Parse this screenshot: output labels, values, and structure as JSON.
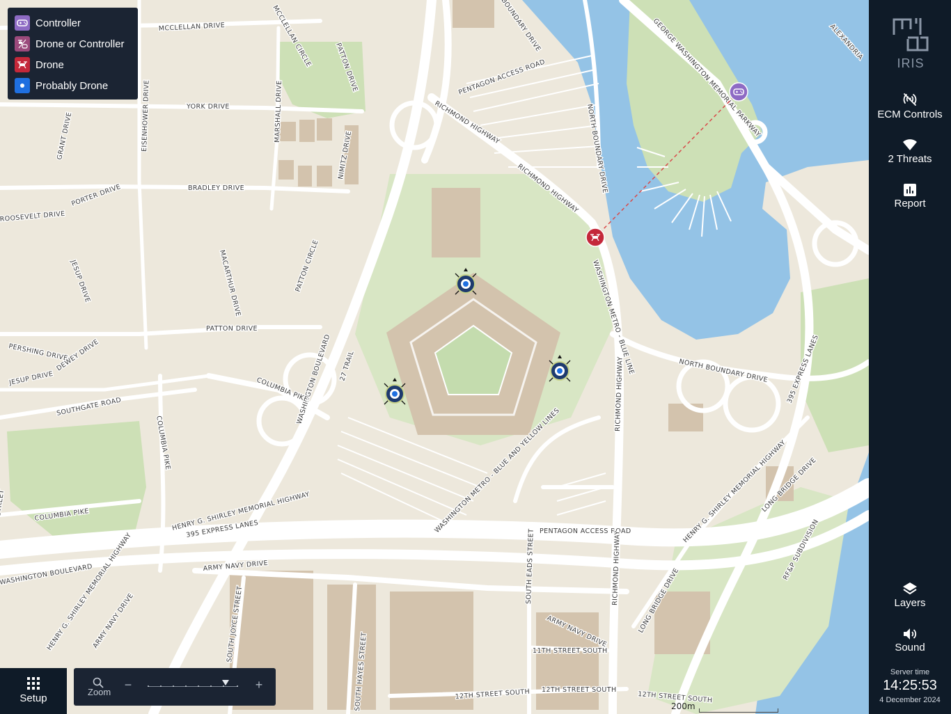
{
  "legend": {
    "items": [
      {
        "label": "Controller",
        "color": "#8e6bc4",
        "icon": "gamepad-icon"
      },
      {
        "label": "Drone or Controller",
        "color": "#9b4a7c",
        "icon": "drone-or-controller-icon"
      },
      {
        "label": "Drone",
        "color": "#c4283a",
        "icon": "drone-icon"
      },
      {
        "label": "Probably Drone",
        "color": "#1f6fe0",
        "icon": "dot-icon"
      }
    ]
  },
  "sidebar": {
    "logo_text": "IRIS",
    "ecm_label": "ECM Controls",
    "threats_label": "2 Threats",
    "report_label": "Report",
    "layers_label": "Layers",
    "sound_label": "Sound",
    "server_time_caption": "Server time",
    "server_time": "14:25:53",
    "server_date": "4 December 2024"
  },
  "controls": {
    "setup_label": "Setup",
    "zoom_label": "Zoom",
    "zoom_minus": "−",
    "zoom_plus": "+",
    "scale_label": "200m"
  },
  "map": {
    "colors": {
      "land": "#ede8dc",
      "water": "#94c3e6",
      "park": "#cde0b6",
      "road": "#ffffff",
      "building": "#d3c3ad"
    },
    "streets": [
      "MCCLELLAN DRIVE",
      "MCCLELLAN CIRCLE",
      "PATTON DRIVE",
      "BOUNDARY DRIVE",
      "PENTAGON ACCESS ROAD",
      "GEORGE WASHINGTON MEMORIAL PARKWAY",
      "ALEXANDRIA",
      "YORK DRIVE",
      "EISENHOWER DRIVE",
      "MARSHALL DRIVE",
      "NIMITZ DRIVE",
      "RICHMOND HIGHWAY",
      "NORTH BOUNDARY DRIVE",
      "GRANT DRIVE",
      "PORTER DRIVE",
      "BRADLEY DRIVE",
      "ROOSEVELT DRIVE",
      "MACARTHUR DRIVE",
      "JESUP DRIVE",
      "PATTON CIRCLE",
      "WASHINGTON METRO - BLUE LINE",
      "PATTON DRIVE",
      "PERSHING DRIVE",
      "DEWEY DRIVE",
      "WASHINGTON BOULEVARD",
      "27 TRAIL",
      "COLUMBIA PIKE",
      "SOUTHGATE ROAD",
      "395 EXPRESS LANES",
      "HENRY G. SHIRLEY MEMORIAL HIGHWAY",
      "WASHINGTON METRO - BLUE AND YELLOW LINES",
      "ARMY NAVY DRIVE",
      "SOUTH JOYCE STREET",
      "SOUTH EADS STREET",
      "11TH STREET SOUTH",
      "12TH STREET SOUTH",
      "SOUTH HAYES STREET",
      "LONG BRIDGE DRIVE",
      "RF&P SUBDIVISION",
      "STREET"
    ]
  },
  "markers": [
    {
      "type": "controller",
      "icon": "gamepad-icon",
      "color": "#8e6bc4"
    },
    {
      "type": "drone",
      "icon": "drone-icon",
      "color": "#c4283a"
    },
    {
      "type": "sensor",
      "icon": "sensor-icon",
      "color": "#1e3a6e"
    },
    {
      "type": "sensor",
      "icon": "sensor-icon",
      "color": "#1e3a6e"
    },
    {
      "type": "sensor",
      "icon": "sensor-icon",
      "color": "#1e3a6e"
    }
  ]
}
